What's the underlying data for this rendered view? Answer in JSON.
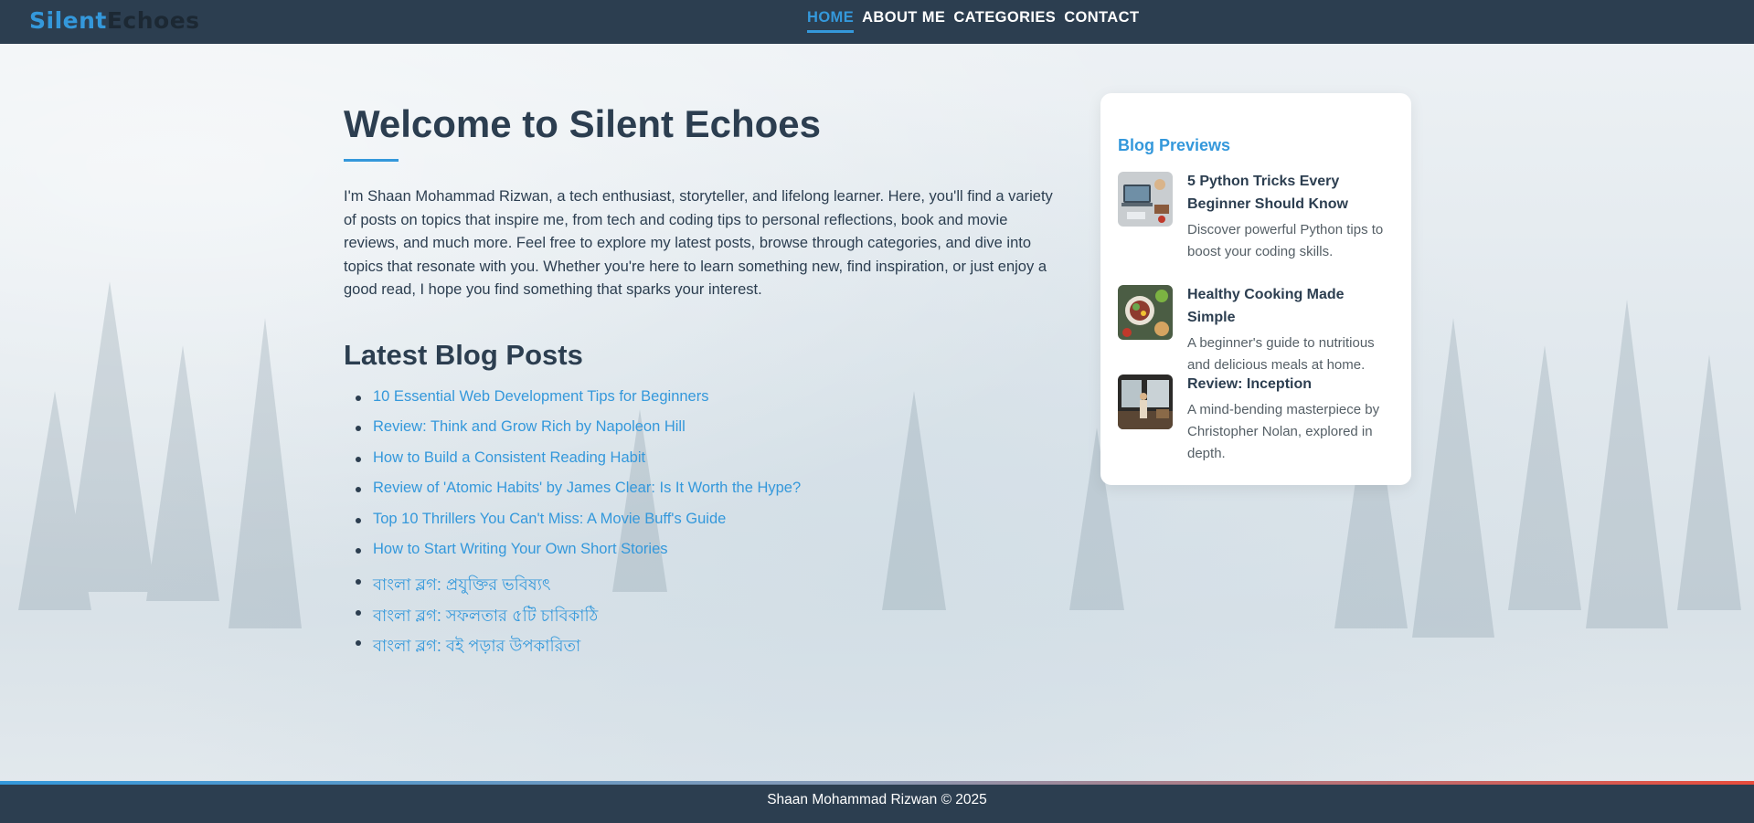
{
  "header": {
    "logo_part1": "Silent",
    "logo_part2": "Echoes",
    "nav": [
      {
        "label": "HOME",
        "active": true
      },
      {
        "label": "ABOUT ME",
        "active": false
      },
      {
        "label": "CATEGORIES",
        "active": false
      },
      {
        "label": "CONTACT",
        "active": false
      }
    ]
  },
  "main": {
    "title": "Welcome to Silent Echoes",
    "intro": "I'm Shaan Mohammad Rizwan, a tech enthusiast, storyteller, and lifelong learner. Here, you'll find a variety of posts on topics that inspire me, from tech and coding tips to personal reflections, book and movie reviews, and much more. Feel free to explore my latest posts, browse through categories, and dive into topics that resonate with you. Whether you're here to learn something new, find inspiration, or just enjoy a good read, I hope you find something that sparks your interest.",
    "latest_heading": "Latest Blog Posts",
    "posts": [
      "10 Essential Web Development Tips for Beginners",
      "Review: Think and Grow Rich by Napoleon Hill",
      "How to Build a Consistent Reading Habit",
      "Review of 'Atomic Habits' by James Clear: Is It Worth the Hype?",
      "Top 10 Thrillers You Can't Miss: A Movie Buff's Guide",
      "How to Start Writing Your Own Short Stories",
      "বাংলা ব্লগ: প্রযুক্তির ভবিষ্যৎ",
      "বাংলা ব্লগ: সফলতার ৫টি চাবিকাঠি",
      "বাংলা ব্লগ: বই পড়ার উপকারিতা"
    ]
  },
  "sidebar": {
    "heading": "Blog Previews",
    "previews": [
      {
        "title": "5 Python Tricks Every Beginner Should Know",
        "desc": "Discover powerful Python tips to boost your coding skills.",
        "thumb": "laptop-desk-thumbnail"
      },
      {
        "title": "Healthy Cooking Made Simple",
        "desc": "A beginner's guide to nutritious and delicious meals at home.",
        "thumb": "food-plate-thumbnail"
      },
      {
        "title": "Review: Inception",
        "desc": "A mind-bending masterpiece by Christopher Nolan, explored in depth.",
        "thumb": "movie-scene-thumbnail"
      }
    ]
  },
  "footer": {
    "text": "Shaan Mohammad Rizwan © 2025"
  },
  "colors": {
    "nav_bg": "#2c3e50",
    "accent": "#3498db",
    "text": "#2c3e50",
    "footer_gradient_end": "#e74c3c"
  }
}
